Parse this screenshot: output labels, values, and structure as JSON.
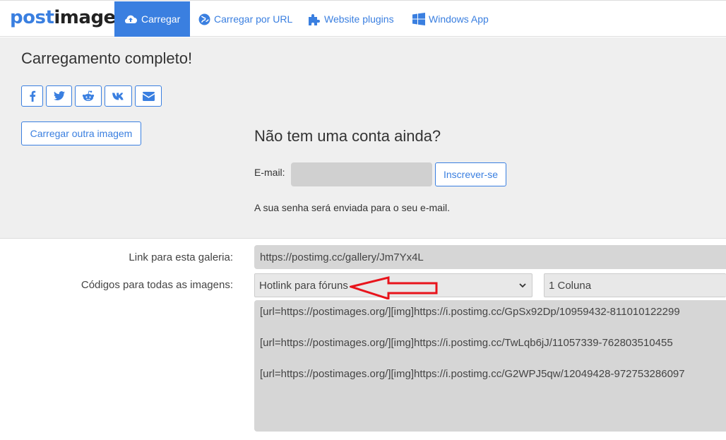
{
  "header": {
    "logo_part1": "post",
    "logo_part2": "image",
    "nav": [
      {
        "label": "Carregar",
        "icon": "cloud-upload-icon",
        "active": true
      },
      {
        "label": "Carregar por URL",
        "icon": "globe-icon"
      },
      {
        "label": "Website plugins",
        "icon": "puzzle-icon"
      },
      {
        "label": "Windows App",
        "icon": "windows-icon"
      }
    ]
  },
  "upload": {
    "title": "Carregamento completo!",
    "share": [
      "facebook-icon",
      "twitter-icon",
      "reddit-icon",
      "vk-icon",
      "envelope-icon"
    ],
    "upload_another_label": "Carregar outra imagem"
  },
  "signup": {
    "title": "Não tem uma conta ainda?",
    "email_label": "E-mail:",
    "email_value": "",
    "subscribe_label": "Inscrever-se",
    "note": "A sua senha será enviada para o seu e-mail."
  },
  "gallery": {
    "link_label": "Link para esta galeria:",
    "link_value": "https://postimg.cc/gallery/Jm7Yx4L",
    "codes_label": "Códigos para todas as imagens:",
    "code_type_selected": "Hotlink para fóruns",
    "columns_selected": "1 Coluna",
    "codes": [
      "[url=https://postimages.org/][img]https://i.postimg.cc/GpSx92Dp/10959432-811010122299",
      "[url=https://postimages.org/][img]https://i.postimg.cc/TwLqb6jJ/11057339-762803510455",
      "[url=https://postimages.org/][img]https://i.postimg.cc/G2WPJ5qw/12049428-972753286097"
    ]
  },
  "colors": {
    "accent": "#3a7fe0",
    "annotation_arrow": "#e8141c"
  }
}
